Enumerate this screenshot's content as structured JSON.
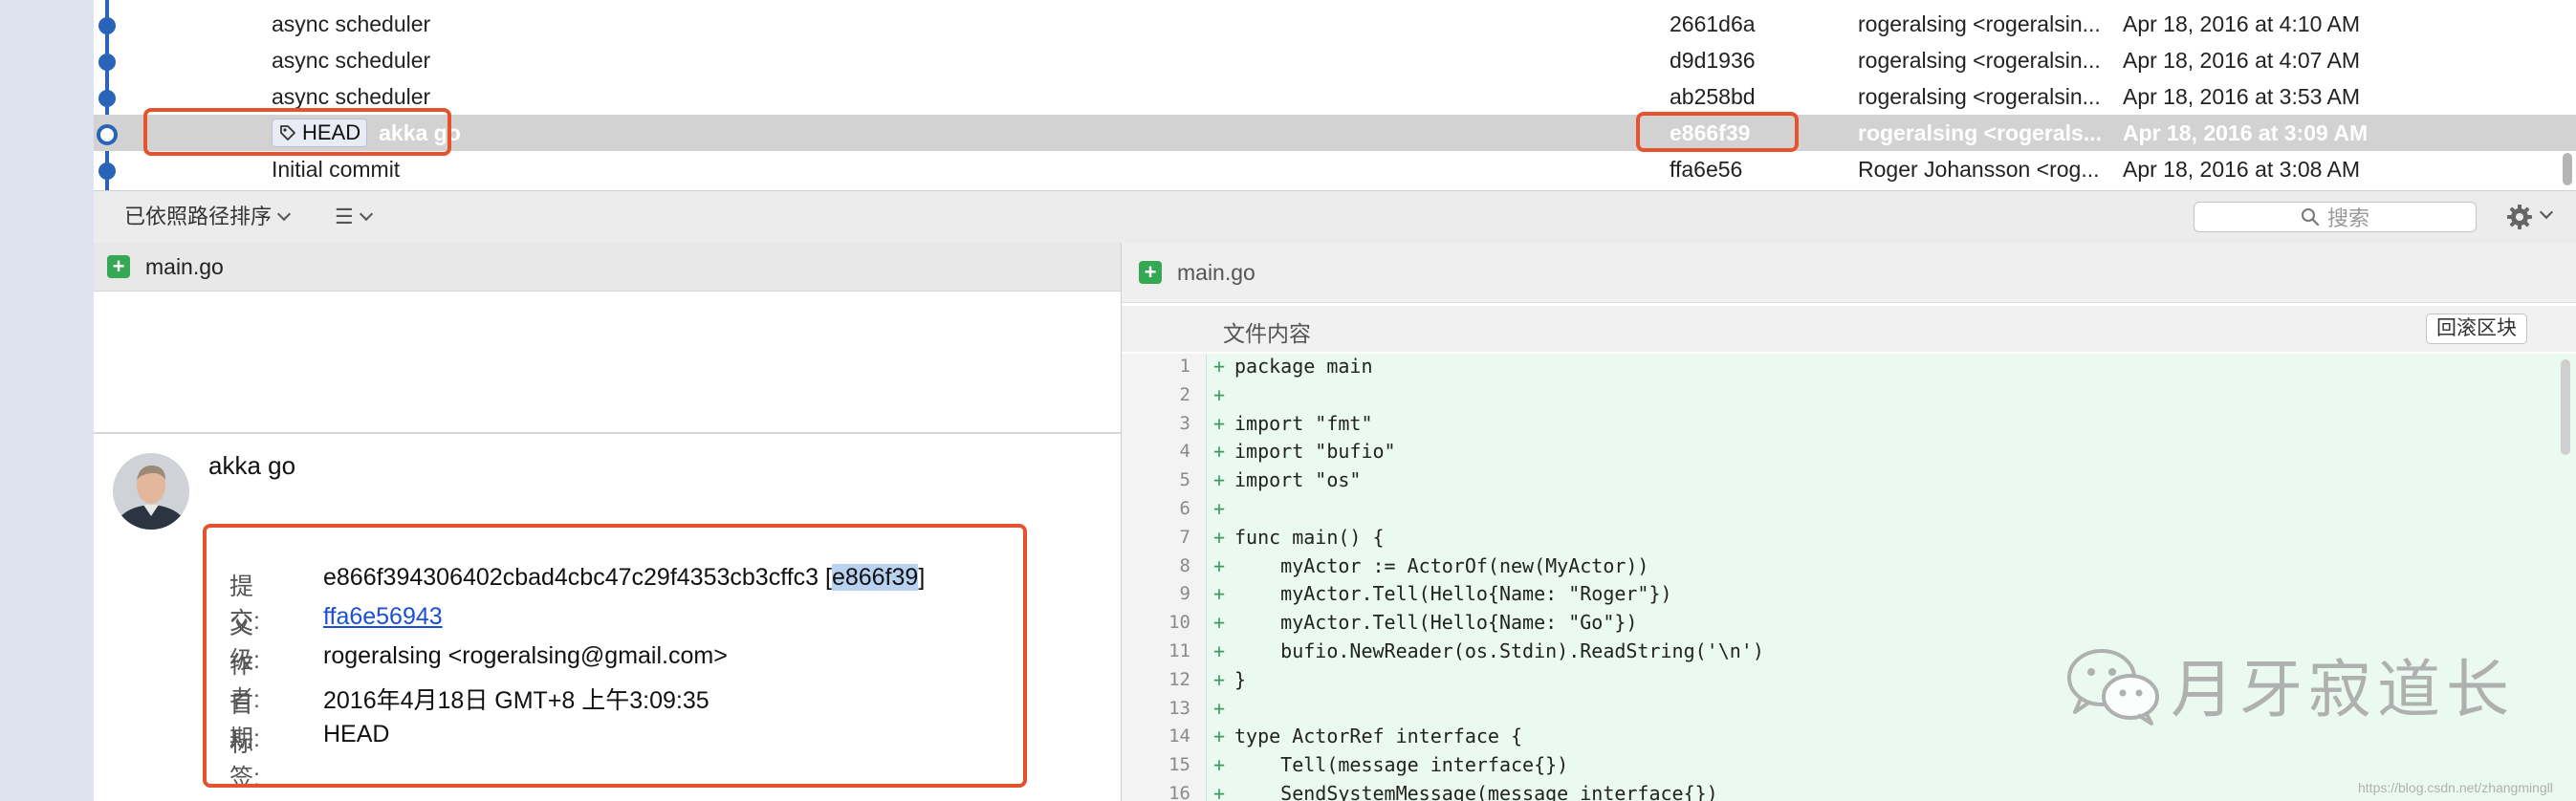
{
  "log": {
    "rows": [
      {
        "message": "async scheduler",
        "tag": "",
        "hash": "2661d6a",
        "author": "rogeralsing <rogeralsin...",
        "date": "Apr 18, 2016 at 4:10 AM",
        "selected": false
      },
      {
        "message": "async scheduler",
        "tag": "",
        "hash": "d9d1936",
        "author": "rogeralsing <rogeralsin...",
        "date": "Apr 18, 2016 at 4:07 AM",
        "selected": false
      },
      {
        "message": "async scheduler",
        "tag": "",
        "hash": "ab258bd",
        "author": "rogeralsing <rogeralsin...",
        "date": "Apr 18, 2016 at 3:53 AM",
        "selected": false
      },
      {
        "message": "akka go",
        "tag": "HEAD",
        "hash": "e866f39",
        "author": "rogeralsing <rogerals...",
        "date": "Apr 18, 2016 at 3:09 AM",
        "selected": true
      },
      {
        "message": "Initial commit",
        "tag": "",
        "hash": "ffa6e56",
        "author": "Roger Johansson <rog...",
        "date": "Apr 18, 2016 at 3:08 AM",
        "selected": false
      }
    ]
  },
  "toolbar": {
    "sort_label": "已依照路径排序",
    "search_placeholder": "搜索"
  },
  "files": {
    "left_file": "main.go",
    "right_file": "main.go"
  },
  "commit": {
    "title": "akka go",
    "commit_label": "提交:",
    "commit_full": "e866f394306402cbad4cbc47c29f4353cb3cffc3 [",
    "commit_short": "e866f39",
    "commit_close": "]",
    "parent_label": "父级:",
    "parent": "ffa6e56943",
    "author_label": "作者:",
    "author": "rogeralsing <rogeralsing@gmail.com>",
    "date_label": "日期:",
    "date": "2016年4月18日 GMT+8 上午3:09:35",
    "tags_label": "标签:",
    "tags": "HEAD"
  },
  "diff": {
    "hunk_title": "文件内容",
    "revert_label": "回滚区块",
    "lines": [
      {
        "n": "1",
        "text": "package main"
      },
      {
        "n": "2",
        "text": ""
      },
      {
        "n": "3",
        "text": "import \"fmt\""
      },
      {
        "n": "4",
        "text": "import \"bufio\""
      },
      {
        "n": "5",
        "text": "import \"os\""
      },
      {
        "n": "6",
        "text": ""
      },
      {
        "n": "7",
        "text": "func main() {"
      },
      {
        "n": "8",
        "text": "    myActor := ActorOf(new(MyActor))"
      },
      {
        "n": "9",
        "text": "    myActor.Tell(Hello{Name: \"Roger\"})"
      },
      {
        "n": "10",
        "text": "    myActor.Tell(Hello{Name: \"Go\"})"
      },
      {
        "n": "11",
        "text": "    bufio.NewReader(os.Stdin).ReadString('\\n')"
      },
      {
        "n": "12",
        "text": "}"
      },
      {
        "n": "13",
        "text": ""
      },
      {
        "n": "14",
        "text": "type ActorRef interface {"
      },
      {
        "n": "15",
        "text": "    Tell(message interface{})"
      },
      {
        "n": "16",
        "text": "    SendSystemMessage(message interface{})"
      }
    ]
  },
  "watermark": {
    "text": "月牙寂道长",
    "url": "https://blog.csdn.net/zhangmingll"
  },
  "colors": {
    "accent": "#2a64b8",
    "annotation": "#e5532e",
    "added_bg": "#eafaf1",
    "link": "#1a4fd6"
  }
}
